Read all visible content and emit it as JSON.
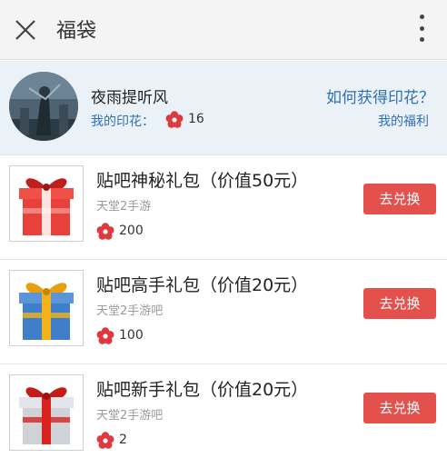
{
  "header": {
    "title": "福袋",
    "close_icon": "close-icon",
    "more_icon": "more-vertical-icon"
  },
  "profile": {
    "username": "夜雨提听风",
    "stamp_label": "我的印花：",
    "stamp_count": "16",
    "how_to_get": "如何获得印花？",
    "my_welfare": "我的福利"
  },
  "items": [
    {
      "name": "贴吧神秘礼包（价值50元）",
      "sub": "天堂2手游",
      "price": "200",
      "button": "去兑换",
      "box_color": "red"
    },
    {
      "name": "贴吧高手礼包（价值20元）",
      "sub": "天堂2手游吧",
      "price": "100",
      "button": "去兑换",
      "box_color": "blue"
    },
    {
      "name": "贴吧新手礼包（价值20元）",
      "sub": "天堂2手游吧",
      "price": "2",
      "button": "去兑换",
      "box_color": "silver"
    }
  ],
  "colors": {
    "accent_blue": "#2f6fb5",
    "button_red": "#e4514d",
    "flower_red": "#e0383f"
  }
}
